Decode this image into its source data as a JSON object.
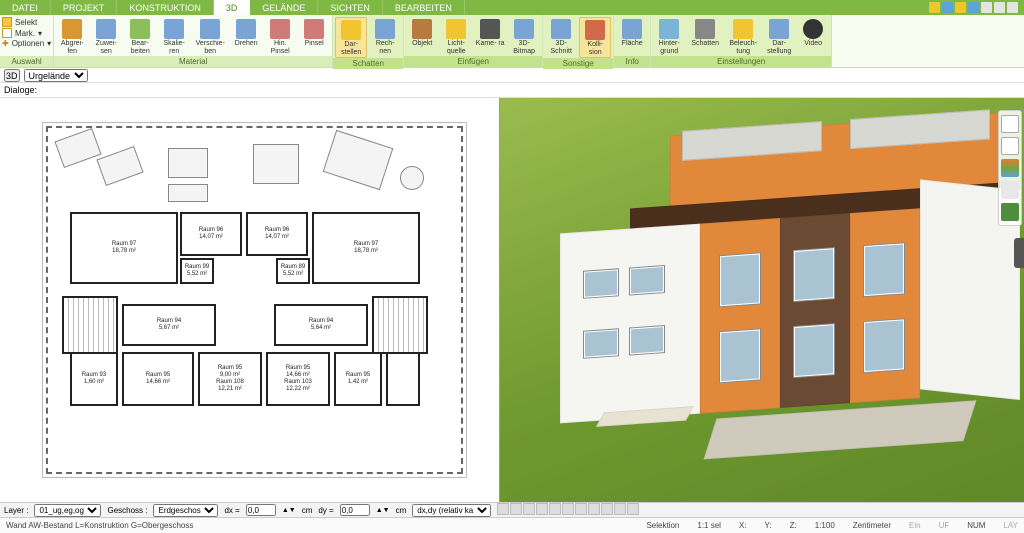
{
  "tabs": [
    "DATEI",
    "PROJEKT",
    "KONSTRUKTION",
    "3D",
    "GELÄNDE",
    "SICHTEN",
    "BEARBEITEN"
  ],
  "active_tab_index": 3,
  "sysicons": [
    "help",
    "min",
    "max",
    "close"
  ],
  "ribbon": {
    "auswahl": {
      "title": "Auswahl",
      "selekt": "Selekt",
      "mark": "Mark.",
      "optionen": "Optionen"
    },
    "material": {
      "title": "Material",
      "items": [
        "Abgrei-\nfen",
        "Zuwei-\nsen",
        "Bear-\nbeiten",
        "Skalie-\nren",
        "Verschie-\nben",
        "Drehen",
        "Hin.\nPinsel",
        "Pinsel"
      ]
    },
    "schatten": {
      "title": "Schatten",
      "items": [
        "Dar-\nstellen",
        "Rech-\nnen"
      ],
      "active_index": 0
    },
    "einfuegen": {
      "title": "Einfügen",
      "items": [
        "Objekt",
        "Licht-\nquelle",
        "Kame-\nra",
        "3D-\nBitmap"
      ]
    },
    "sonstige": {
      "title": "Sonstige",
      "items": [
        "3D-\nSchnitt",
        "Kolli-\nsion"
      ],
      "active_index": 1
    },
    "info": {
      "title": "Info",
      "items": [
        "Fläche"
      ]
    },
    "einstellungen": {
      "title": "Einstellungen",
      "items": [
        "Hinter-\ngrund",
        "Schatten",
        "Beleuch-\ntung",
        "Dar-\nstellung",
        "Video"
      ]
    }
  },
  "subbar": {
    "btn3d": "3D",
    "dropdown": "Urgelände"
  },
  "dialogbar": {
    "label": "Dialoge:"
  },
  "plan": {
    "rooms": [
      {
        "name": "Raum 97",
        "area": "18,78 m²"
      },
      {
        "name": "Raum 99",
        "area": "5,52 m²"
      },
      {
        "name": "Raum 96",
        "area": "14,07 m²"
      },
      {
        "name": "Raum 96",
        "area": "14,07 m²"
      },
      {
        "name": "Raum 89",
        "area": "5,52 m²"
      },
      {
        "name": "Raum 97",
        "area": "18,78 m²"
      },
      {
        "name": "Raum 94",
        "area": "5,67 m²"
      },
      {
        "name": "Raum 94",
        "area": "5,64 m²"
      },
      {
        "name": "Raum 93",
        "area": "1,60 m²"
      },
      {
        "name": "Raum 95",
        "area": "14,66 m²"
      },
      {
        "name": "Raum 95\n9,00 m²\nRaum 108\n12,21 m²",
        "area": ""
      },
      {
        "name": "Raum 95\n14,66 m²\nRaum 103\n12,22 m²",
        "area": ""
      },
      {
        "name": "Raum 95",
        "area": "1,42 m²"
      }
    ]
  },
  "palette_colors": [
    "#79a4ca",
    "#d9d9d9",
    "#7aa33a",
    "#e07b3b",
    "#e4e4e4",
    "#4f8d3d"
  ],
  "bottom": {
    "layer_label": "Layer :",
    "layer_value": "01_ug,eg,og",
    "geschoss_label": "Geschoss :",
    "geschoss_value": "Erdgeschos",
    "dx_label": "dx =",
    "dx_value": "0,0",
    "cm1": "cm",
    "dy_label": "dy =",
    "dy_value": "0,0",
    "cm2": "cm",
    "mode": "dx,dy (relativ ka"
  },
  "status": {
    "left": "Wand AW-Bestand L=Konstruktion G=Obergeschoss",
    "selektion": "Selektion",
    "sel": "1:1 sel",
    "x": "X:",
    "y": "Y:",
    "z": "Z:",
    "scale": "1:100",
    "unit": "Zentimeter",
    "ein": "Ein",
    "uf": "UF",
    "num": "NUM",
    "lay": "LAY"
  }
}
